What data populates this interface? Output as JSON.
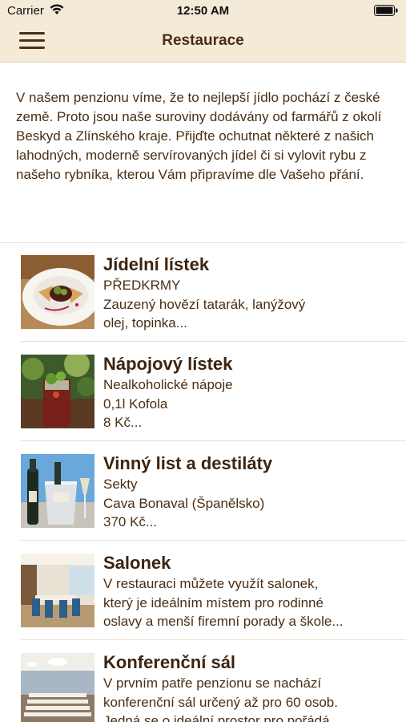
{
  "status_bar": {
    "carrier": "Carrier",
    "time": "12:50 AM"
  },
  "nav": {
    "title": "Restaurace",
    "menu_icon": "hamburger-menu-icon"
  },
  "intro": {
    "text": "V našem penzionu víme, že to nejlepší jídlo pochází z české země. Proto jsou naše suroviny dodávány od farmářů z okolí Beskyd a Zlínského kraje. Přijďte ochutnat některé z našich lahodných, moderně servírovaných jídel či si vylovit rybu z našeho rybníka, kterou Vám připravíme dle Vašeho přání."
  },
  "items": [
    {
      "title": "Jídelní lístek",
      "lines": [
        "PŘEDKRMY",
        "Zauzený hovězí tatarák, lanýžový",
        "olej, topinka..."
      ],
      "image": "plated-dish-photo"
    },
    {
      "title": "Nápojový lístek",
      "lines": [
        "Nealkoholické nápoje",
        "0,1l Kofola",
        "8 Kč..."
      ],
      "image": "cocktail-glass-photo"
    },
    {
      "title": "Vinný list a destiláty",
      "lines": [
        "Sekty",
        "Cava Bonaval (Španělsko)",
        "370 Kč..."
      ],
      "image": "champagne-bucket-photo"
    },
    {
      "title": "Salonek",
      "lines": [
        "V restauraci můžete využít salonek,",
        "který je ideálním místem pro rodinné",
        "oslavy a menší firemní porady a škole..."
      ],
      "image": "dining-room-photo"
    },
    {
      "title": "Konferenční sál",
      "lines": [
        "V prvním patře penzionu se nachází",
        "konferenční sál určený až pro 60 osob.",
        "Jedná se o ideální prostor pro pořádá..."
      ],
      "image": "conference-hall-photo"
    }
  ],
  "colors": {
    "header_bg": "#f4ead8",
    "text_brown": "#4a2e14"
  }
}
